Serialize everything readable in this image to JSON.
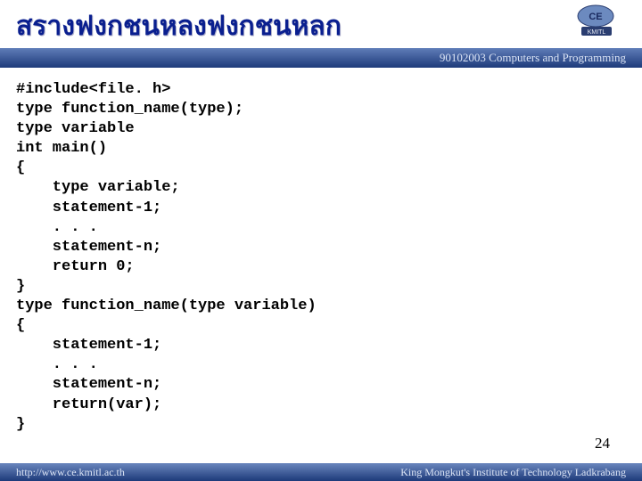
{
  "title": "สรางฟงกชนหลงฟงกชนหลก",
  "header": {
    "course": "90102003 Computers and Programming"
  },
  "code": "#include<file. h>\ntype function_name(type);\ntype variable\nint main()\n{\n    type variable;\n    statement-1;\n    . . .\n    statement-n;\n    return 0;\n}\ntype function_name(type variable)\n{\n    statement-1;\n    . . .\n    statement-n;\n    return(var);\n}",
  "page_number": "24",
  "footer": {
    "url": "http://www.ce.kmitl.ac.th",
    "institution": "King Mongkut's Institute of Technology Ladkrabang"
  }
}
